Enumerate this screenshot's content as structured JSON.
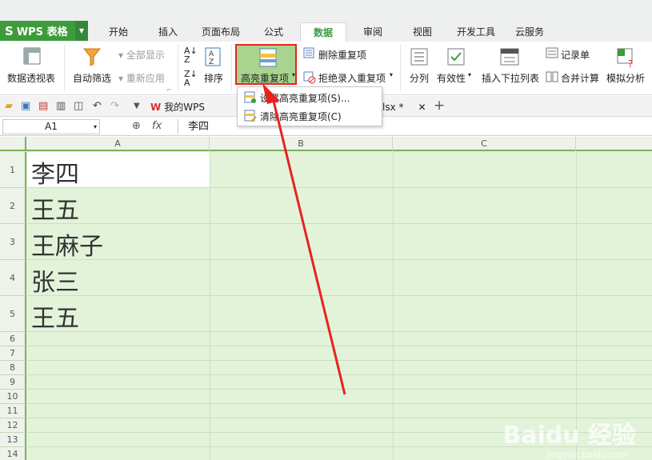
{
  "app": {
    "name": "WPS 表格"
  },
  "ribbon_tabs": [
    "开始",
    "插入",
    "页面布局",
    "公式",
    "数据",
    "审阅",
    "视图",
    "开发工具",
    "云服务"
  ],
  "ribbon_active": "数据",
  "ribbon": {
    "pivot": "数据透视表",
    "autofilter": "自动筛选",
    "show_all": "全部显示",
    "reapply": "重新应用",
    "sort": "排序",
    "highlight_dup": "高亮重复项",
    "remove_dup": "删除重复项",
    "reject_dup": "拒绝录入重复项",
    "split": "分列",
    "validity": "有效性",
    "insert_dropdown": "插入下拉列表",
    "record_form": "记录单",
    "merge_calc": "合并计算",
    "simulate": "模拟分析"
  },
  "dropdown_menu": {
    "items": [
      "设置高亮重复项(S)...",
      "清除高亮重复项(C)"
    ]
  },
  "doc_tabs": {
    "wps": "我的WPS",
    "file_suffix": "lsx *"
  },
  "formula_bar": {
    "cell_ref": "A1",
    "fx": "fx",
    "content": "李四"
  },
  "columns": [
    "A",
    "B",
    "C"
  ],
  "rows": [
    "1",
    "2",
    "3",
    "4",
    "5",
    "6",
    "7",
    "8",
    "9",
    "10",
    "11",
    "12",
    "13",
    "14"
  ],
  "cells": {
    "A": [
      "李四",
      "王五",
      "王麻子",
      "张三",
      "王五"
    ]
  },
  "colors": {
    "brand_green": "#3e9b3b",
    "highlight_fill": "#e3f3da",
    "annotation_red": "#e8231f"
  },
  "watermark": {
    "main": "Baidu 经验",
    "sub": "jingyan.baidu.com"
  }
}
